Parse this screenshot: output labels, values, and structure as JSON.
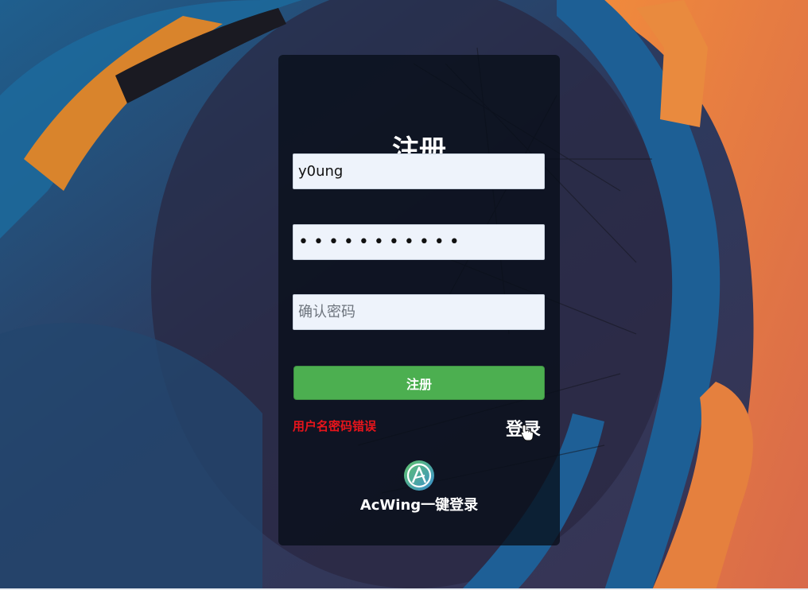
{
  "form": {
    "title": "注册",
    "username_value": "y0ung",
    "password_value": "•••••••••••",
    "confirm_placeholder": "确认密码",
    "submit_label": "注册",
    "error_message": "用户名密码错误",
    "login_link": "登录"
  },
  "acwing": {
    "logo_icon": "acwing-logo-icon",
    "label": "AcWing一键登录"
  },
  "colors": {
    "submit_bg": "#4caf50",
    "error_text": "#e8141b",
    "card_bg": "#080e18"
  }
}
